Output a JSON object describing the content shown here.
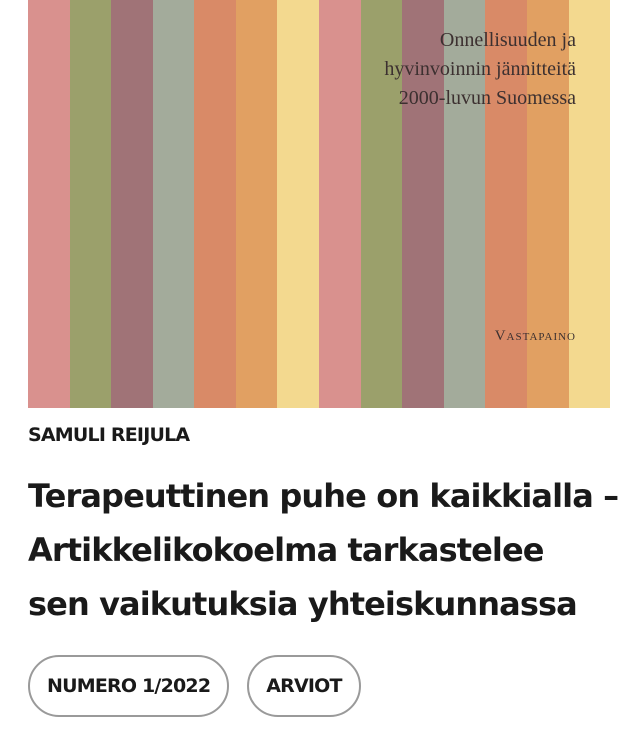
{
  "cover": {
    "stripe_colors": [
      "#d9918e",
      "#9ba06b",
      "#a07377",
      "#a3ab9b",
      "#d98a67",
      "#e1a062",
      "#f3d98f",
      "#d9918e",
      "#9ba06b",
      "#a07377",
      "#a3ab9b",
      "#d98a67",
      "#e1a062",
      "#f3d98f"
    ],
    "subtitle_lines": [
      "Onnellisuuden ja",
      "hyvinvoinnin jännitteitä",
      "2000-luvun Suomessa"
    ],
    "publisher": "Vastapaino"
  },
  "article": {
    "author": "SAMULI REIJULA",
    "title_lines": [
      "Terapeuttinen puhe on kaikkialla –",
      "Artikkelikokoelma tarkastelee",
      "sen vaikutuksia yhteiskunnassa"
    ]
  },
  "tags": [
    {
      "label": "NUMERO 1/2022"
    },
    {
      "label": "ARVIOT"
    }
  ]
}
